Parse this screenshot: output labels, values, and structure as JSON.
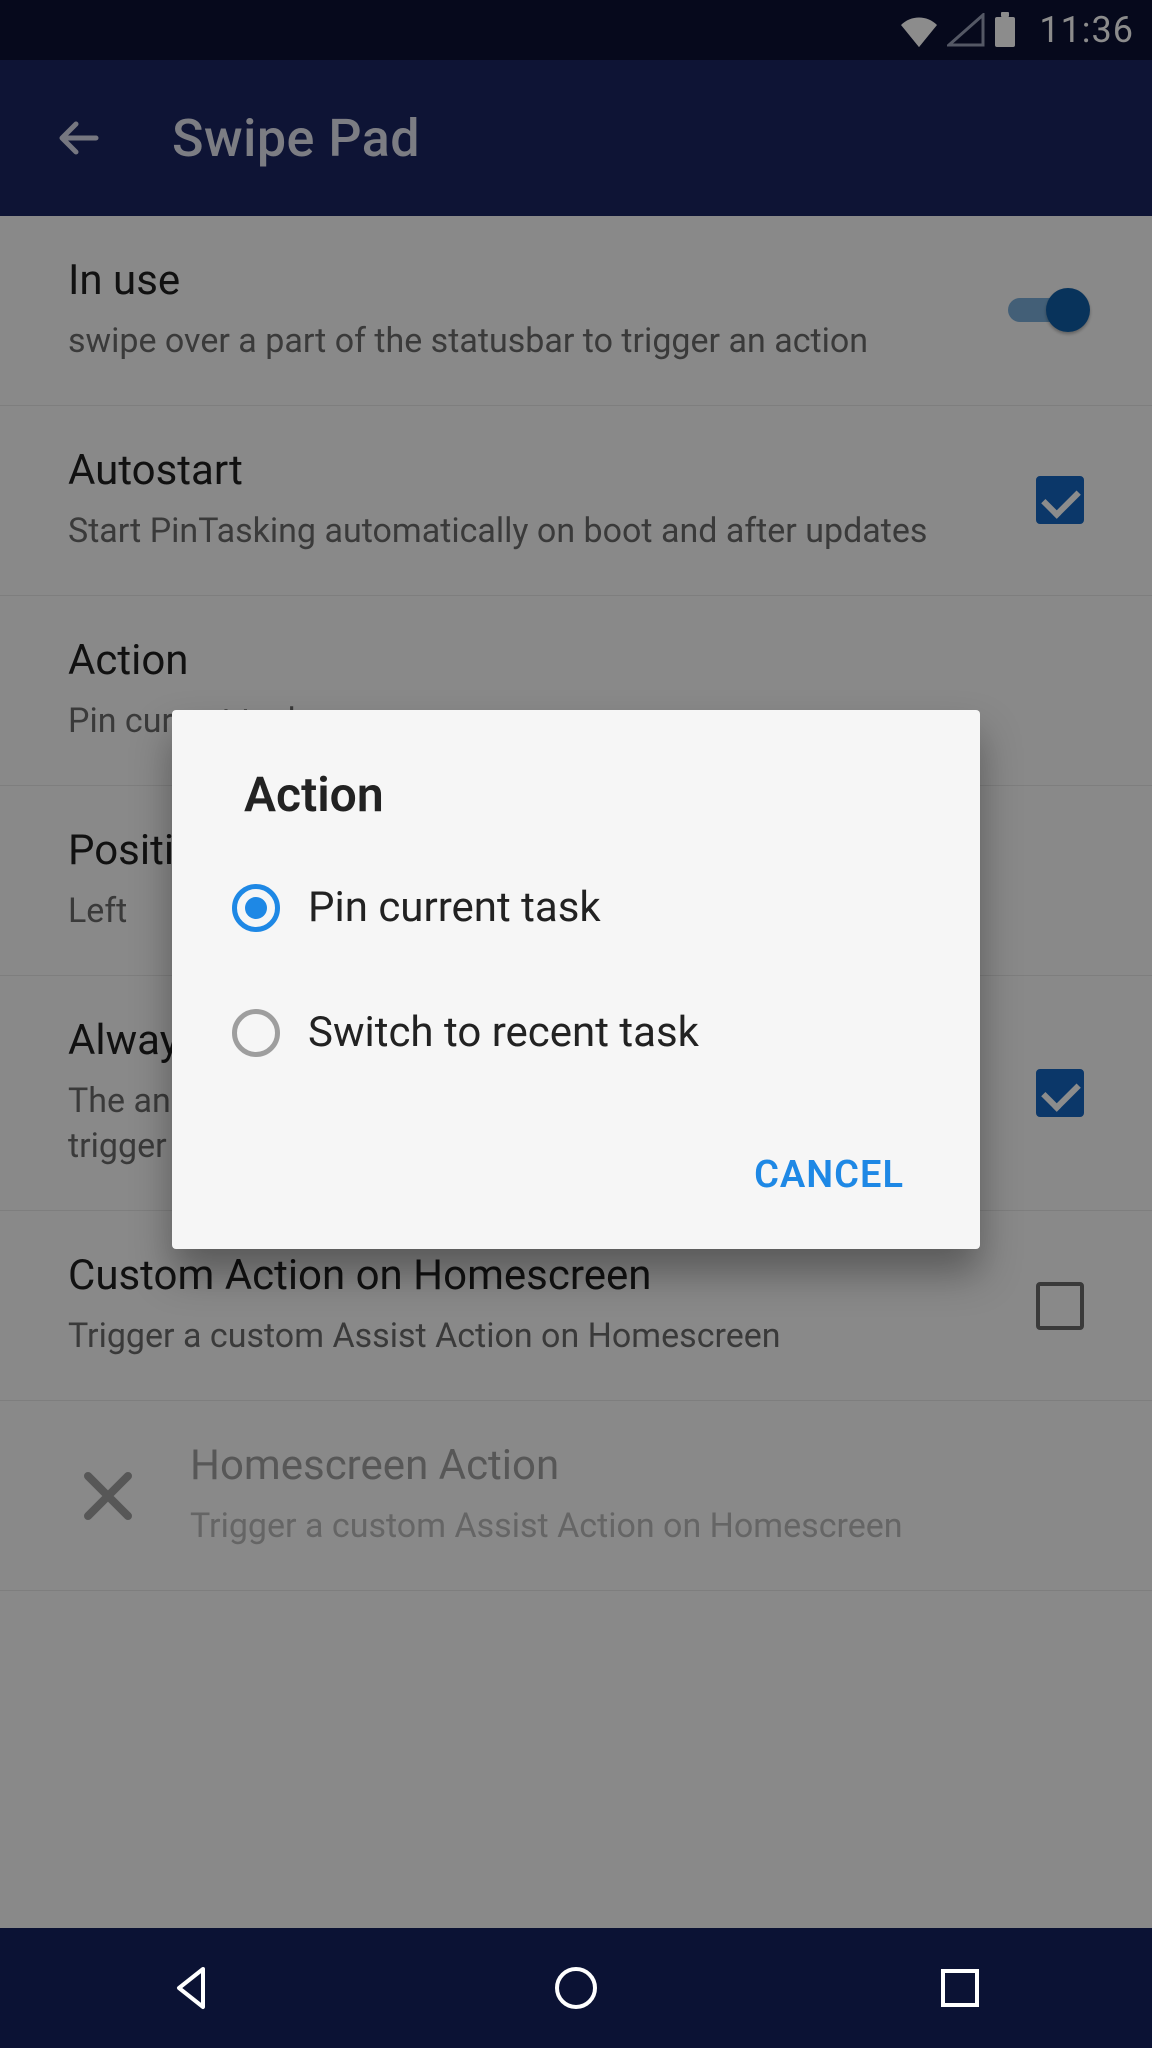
{
  "status": {
    "time": "11:36"
  },
  "appbar": {
    "title": "Swipe Pad"
  },
  "settings": {
    "in_use": {
      "title": "In use",
      "sub": "swipe over a part of the statusbar to trigger an action",
      "on": true
    },
    "autostart": {
      "title": "Autostart",
      "sub": "Start PinTasking automatically on boot and after updates",
      "checked": true
    },
    "action": {
      "title": "Action",
      "sub": "Pin current task"
    },
    "position": {
      "title": "Position",
      "sub": "Left"
    },
    "always_center": {
      "title": "Always animate in the center",
      "sub": "The animation will appear in the center even when you trigger it on the sides",
      "checked": true
    },
    "custom_home": {
      "title": "Custom Action on Homescreen",
      "sub": "Trigger a custom Assist Action on Homescreen",
      "checked": false
    },
    "homescreen_action": {
      "title": "Homescreen Action",
      "sub": "Trigger a custom Assist Action on Homescreen"
    }
  },
  "dialog": {
    "title": "Action",
    "options": [
      {
        "label": "Pin current task",
        "selected": true
      },
      {
        "label": "Switch to recent task",
        "selected": false
      }
    ],
    "cancel": "CANCEL"
  }
}
